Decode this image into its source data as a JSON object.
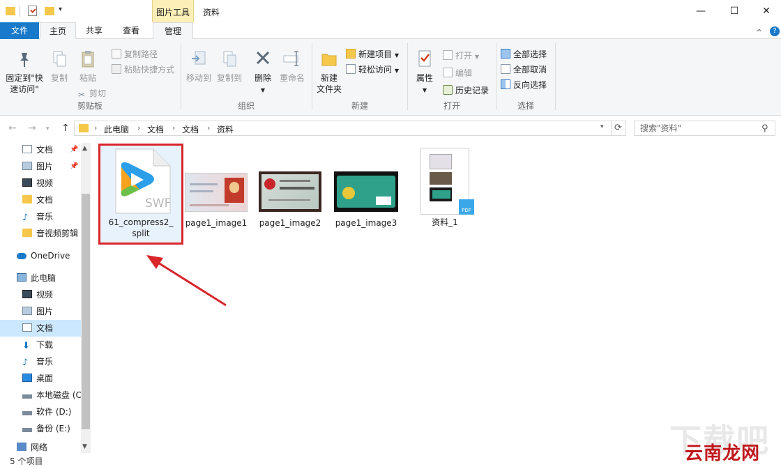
{
  "window": {
    "title": "资料",
    "tool_tab": "图片工具",
    "minimize": "—",
    "maximize": "☐",
    "close": "✕"
  },
  "tabs": {
    "file": "文件",
    "home": "主页",
    "share": "共享",
    "view": "查看",
    "manage": "管理"
  },
  "ribbon": {
    "clipboard": {
      "label": "剪贴板",
      "pin_line1": "固定到\"快",
      "pin_line2": "速访问\"",
      "copy": "复制",
      "paste": "粘贴",
      "copy_path": "复制路径",
      "paste_shortcut": "粘贴快捷方式",
      "cut": "剪切"
    },
    "organize": {
      "label": "组织",
      "move_to": "移动到",
      "copy_to": "复制到",
      "delete": "删除",
      "rename": "重命名"
    },
    "new": {
      "label": "新建",
      "new_folder_line1": "新建",
      "new_folder_line2": "文件夹",
      "new_item": "新建项目",
      "easy_access": "轻松访问"
    },
    "open": {
      "label": "打开",
      "properties": "属性",
      "open": "打开",
      "edit": "编辑",
      "history": "历史记录"
    },
    "select": {
      "label": "选择",
      "select_all": "全部选择",
      "select_none": "全部取消",
      "invert": "反向选择"
    }
  },
  "address": {
    "crumbs": [
      "此电脑",
      "文档",
      "文档",
      "资料"
    ],
    "search_placeholder": "搜索\"资料\""
  },
  "nav": {
    "quick": [
      {
        "label": "文档",
        "icon": "document-icon",
        "pinned": true
      },
      {
        "label": "图片",
        "icon": "picture-icon",
        "pinned": true
      },
      {
        "label": "视频",
        "icon": "video-icon",
        "pinned": false
      },
      {
        "label": "文档",
        "icon": "folder-icon",
        "pinned": false
      },
      {
        "label": "音乐",
        "icon": "music-icon",
        "pinned": false
      },
      {
        "label": "音视频剪辑",
        "icon": "folder-icon",
        "pinned": false
      }
    ],
    "onedrive": "OneDrive",
    "this_pc": "此电脑",
    "pc_items": [
      {
        "label": "视频",
        "icon": "video-icon"
      },
      {
        "label": "图片",
        "icon": "picture-icon"
      },
      {
        "label": "文档",
        "icon": "document-icon",
        "selected": true
      },
      {
        "label": "下载",
        "icon": "download-icon"
      },
      {
        "label": "音乐",
        "icon": "music-icon"
      },
      {
        "label": "桌面",
        "icon": "desktop-icon"
      },
      {
        "label": "本地磁盘 (C",
        "icon": "drive-icon"
      },
      {
        "label": "软件 (D:)",
        "icon": "drive-icon"
      },
      {
        "label": "备份 (E:)",
        "icon": "drive-icon"
      },
      {
        "label": "网络",
        "icon": "network-icon"
      }
    ]
  },
  "files": [
    {
      "name_line1": "61_compress2_",
      "name_line2": "split",
      "type": "swf"
    },
    {
      "name": "page1_image1",
      "type": "image"
    },
    {
      "name": "page1_image2",
      "type": "image"
    },
    {
      "name": "page1_image3",
      "type": "image"
    },
    {
      "name": "资料_1",
      "type": "pdf"
    }
  ],
  "swf_badge": "SWF",
  "pdf_badge": "PDF",
  "status": {
    "count": "5 个项目"
  },
  "watermark": {
    "text": "云南龙网",
    "bg": "下载吧"
  },
  "colors": {
    "accent": "#1979ca",
    "highlight": "#d8262b",
    "tool_tab": "#fcf0b8"
  }
}
